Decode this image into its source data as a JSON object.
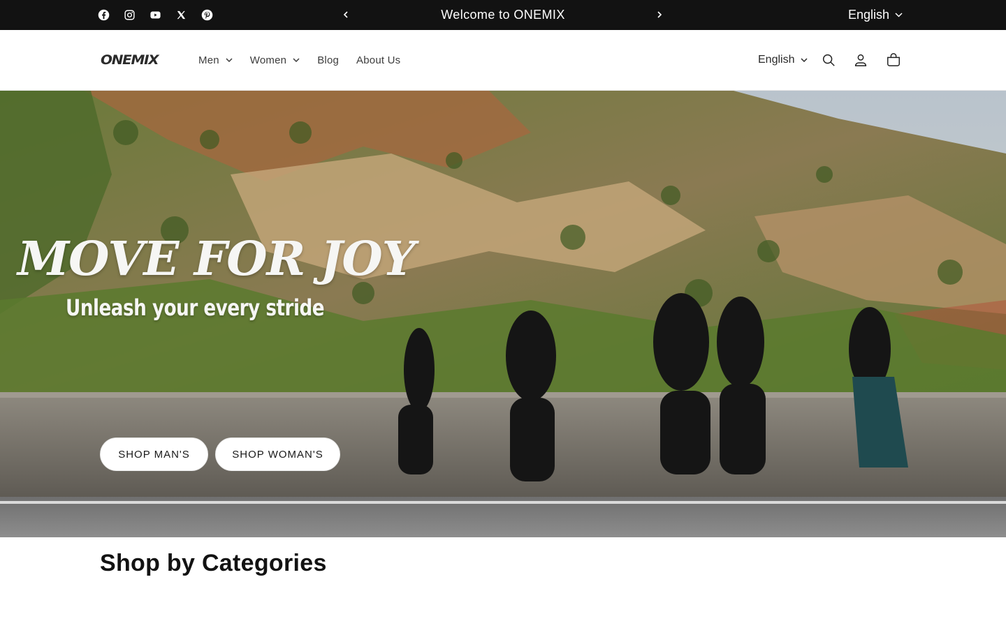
{
  "announcement": {
    "social_icons": [
      "facebook-icon",
      "instagram-icon",
      "youtube-icon",
      "x-icon",
      "pinterest-icon"
    ],
    "message": "Welcome to ONEMIX",
    "language": "English"
  },
  "header": {
    "logo": "ONEMIX",
    "nav": [
      {
        "label": "Men",
        "has_dropdown": true
      },
      {
        "label": "Women",
        "has_dropdown": true
      },
      {
        "label": "Blog",
        "has_dropdown": false
      },
      {
        "label": "About Us",
        "has_dropdown": false
      }
    ],
    "language": "English",
    "icons": [
      "search-icon",
      "account-icon",
      "cart-icon"
    ]
  },
  "hero": {
    "title": "MOVE FOR JOY",
    "subtitle": "Unleash your every stride",
    "buttons": [
      "SHOP MAN'S",
      "SHOP WOMAN'S"
    ]
  },
  "categories": {
    "title": "Shop by Categories"
  },
  "colors": {
    "announcement_bg": "#121212",
    "text": "#121212",
    "button_bg": "#ffffff"
  }
}
